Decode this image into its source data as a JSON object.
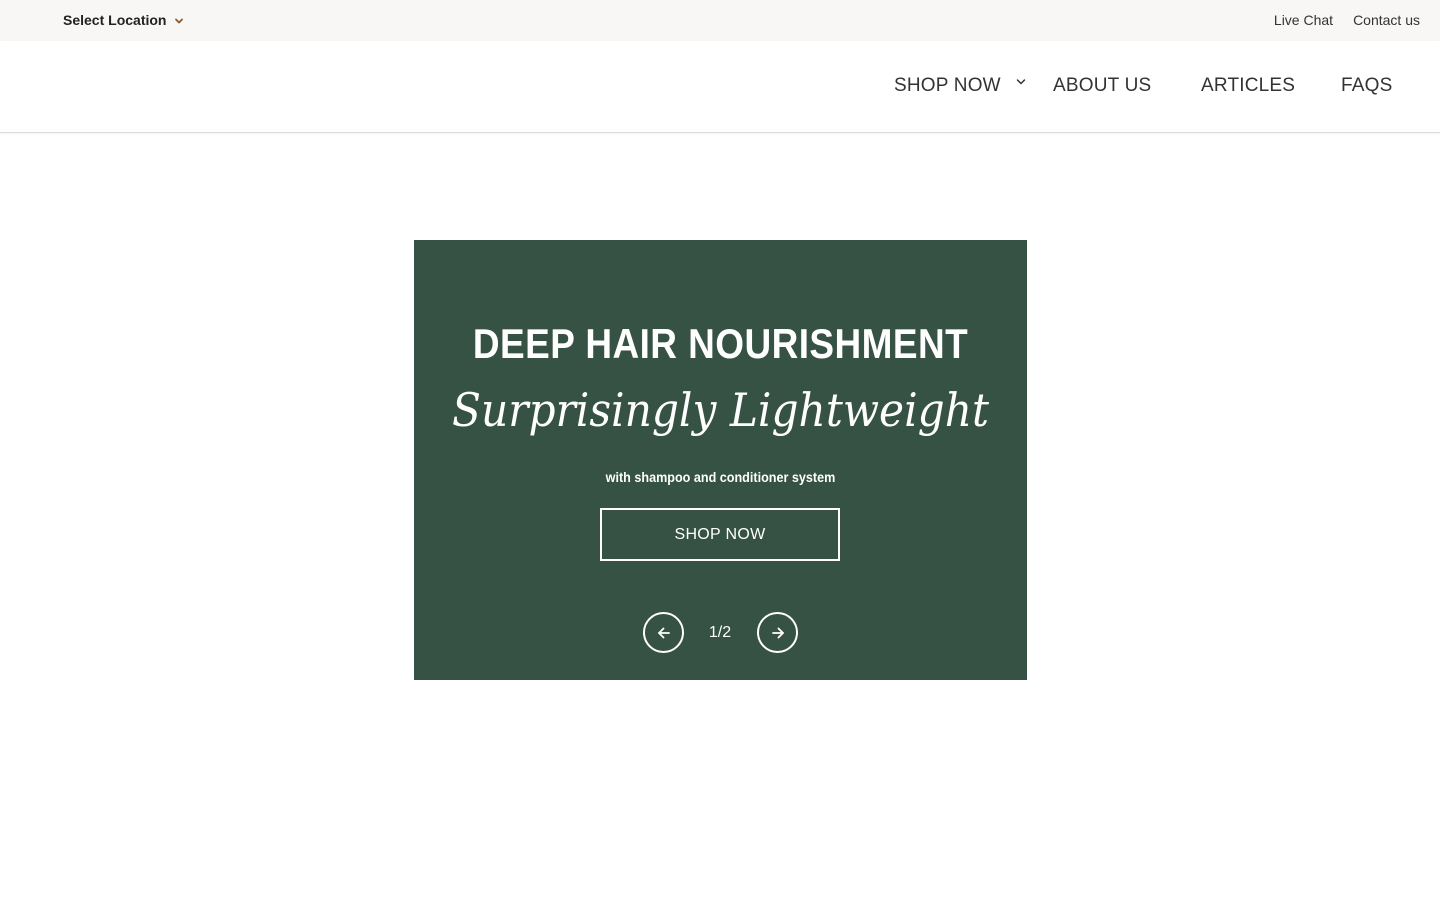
{
  "utility_bar": {
    "location_label": "Select Location",
    "location_icon": "chevron-down-icon",
    "links": [
      {
        "label": "Live Chat"
      },
      {
        "label": "Contact us"
      }
    ]
  },
  "nav": {
    "items": [
      {
        "label": "SHOP NOW",
        "has_dropdown": true
      },
      {
        "label": "ABOUT US"
      },
      {
        "label": "ARTICLES"
      },
      {
        "label": "FAQS"
      }
    ]
  },
  "hero": {
    "heading": "DEEP HAIR NOURISHMENT",
    "subheading": "Surprisingly Lightweight",
    "tagline": "with shampoo and conditioner system",
    "cta_label": "SHOP NOW",
    "slide_counter": "1/2",
    "prev_icon": "arrow-left-icon",
    "next_icon": "arrow-right-icon"
  },
  "colors": {
    "hero_background": "#365244",
    "utility_background": "#f8f7f5",
    "location_chevron": "#8b5a2b",
    "text_dark": "#222222",
    "text_light": "#ffffff"
  }
}
